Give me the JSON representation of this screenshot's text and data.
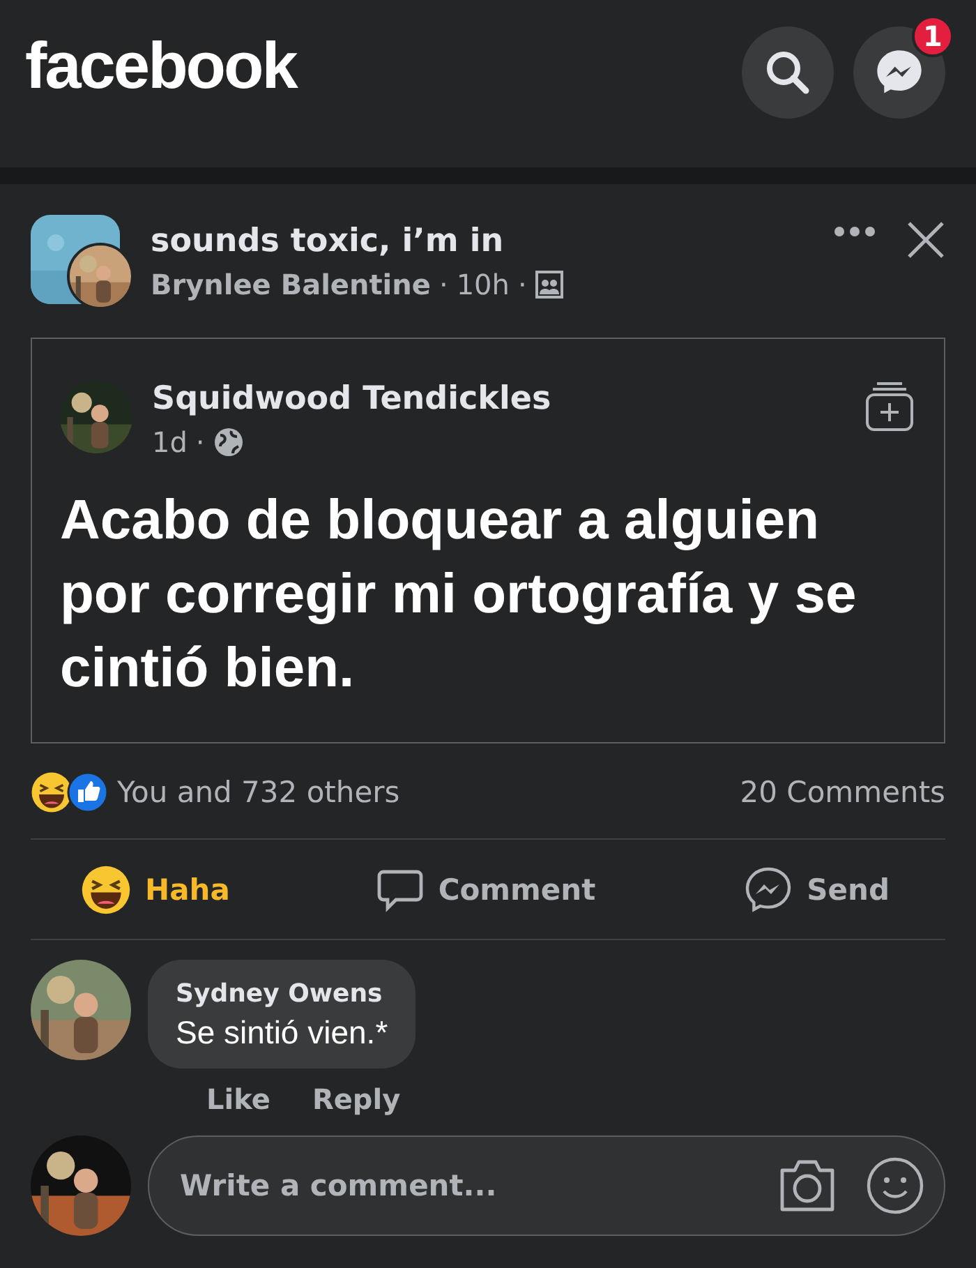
{
  "header": {
    "logo": "facebook",
    "messenger_badge": "1"
  },
  "post": {
    "group": "sounds toxic, i’m in",
    "author": "Brynlee Balentine",
    "separator_1": "·",
    "time": "10h",
    "separator_2": "·",
    "shared": {
      "author": "Squidwood Tendickles",
      "time": "1d",
      "separator": "·",
      "text": "Acabo de bloquear a alguien por corregir mi ortografía y se cintió bien."
    },
    "reactions": {
      "summary": "You and 732 others",
      "comments": "20 Comments"
    },
    "actions": [
      {
        "kind": "haha",
        "label": "Haha",
        "selected": true
      },
      {
        "kind": "comment",
        "label": "Comment",
        "selected": false
      },
      {
        "kind": "send",
        "label": "Send",
        "selected": false
      }
    ]
  },
  "comments": [
    {
      "name": "Sydney Owens",
      "text": "Se sintió vien.*",
      "actions": [
        "Like",
        "Reply"
      ]
    }
  ],
  "composer": {
    "placeholder": "Write a comment..."
  }
}
